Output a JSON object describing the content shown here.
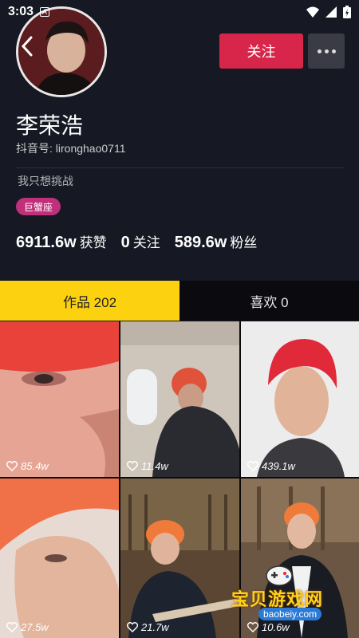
{
  "status_bar": {
    "time": "3:03",
    "notification_badge": "A"
  },
  "profile": {
    "name": "李荣浩",
    "douyin_id": "抖音号: lironghao0711",
    "bio": "我只想挑战",
    "tag": "巨蟹座",
    "follow_label": "关注"
  },
  "stats": [
    {
      "value": "6911.6w",
      "label": "获赞"
    },
    {
      "value": "0",
      "label": "关注"
    },
    {
      "value": "589.6w",
      "label": "粉丝"
    }
  ],
  "tabs": [
    {
      "label": "作品 202",
      "active": true
    },
    {
      "label": "喜欢 0",
      "active": false
    }
  ],
  "videos": [
    {
      "likes": "85.4w"
    },
    {
      "likes": "11.4w"
    },
    {
      "likes": "439.1w"
    },
    {
      "likes": "27.5w"
    },
    {
      "likes": "21.7w"
    },
    {
      "likes": "10.6w"
    }
  ],
  "watermark": {
    "text": "宝贝游戏网",
    "url": "baobeiy.com"
  },
  "colors": {
    "follow": "#d7264a",
    "tab_active": "#fcd110",
    "tag": "#c0307a",
    "background": "#161823"
  }
}
